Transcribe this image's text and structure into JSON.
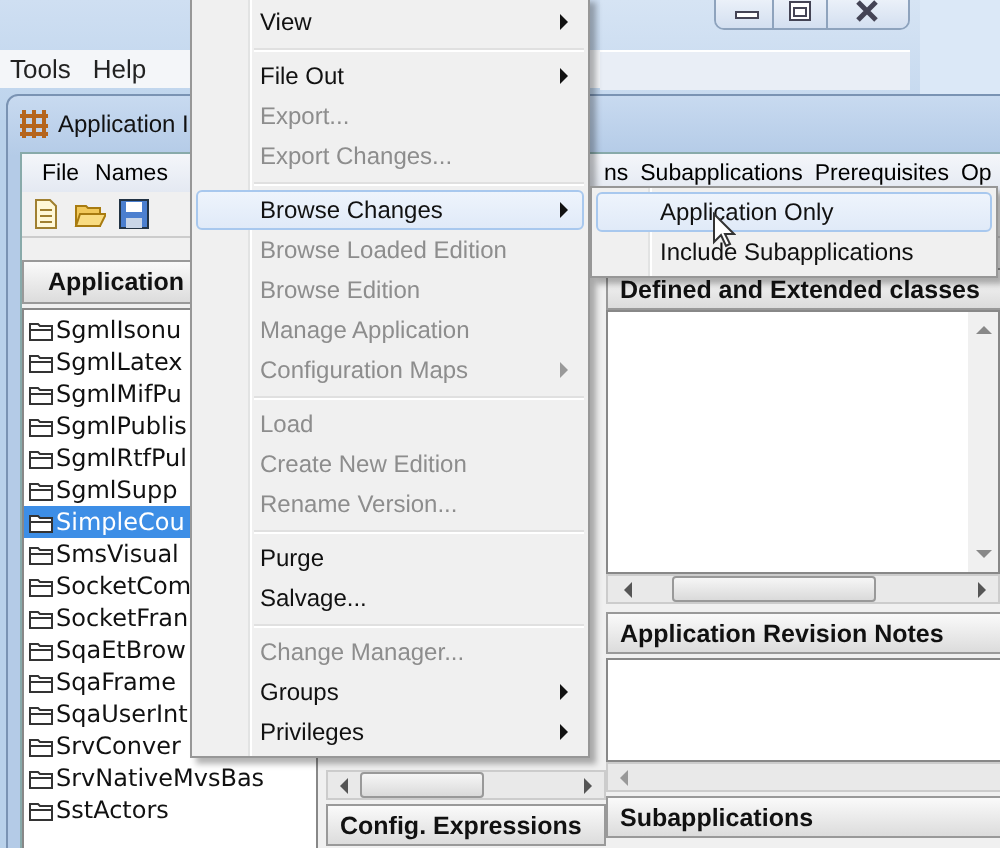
{
  "background_window": {
    "menu": [
      "Tools",
      "Help"
    ]
  },
  "app_window": {
    "title": "Application I",
    "menu": [
      "File",
      "Names",
      "ns",
      "Subapplications",
      "Prerequisites",
      "Op"
    ],
    "applications_header": "Application",
    "applications": [
      {
        "name": "SgmlIsonu",
        "selected": false
      },
      {
        "name": "SgmlLatex",
        "selected": false
      },
      {
        "name": "SgmlMifPu",
        "selected": false
      },
      {
        "name": "SgmlPublis",
        "selected": false
      },
      {
        "name": "SgmlRtfPul",
        "selected": false
      },
      {
        "name": "SgmlSupp",
        "selected": false
      },
      {
        "name": "SimpleCou",
        "selected": true
      },
      {
        "name": "SmsVisual",
        "selected": false
      },
      {
        "name": "SocketCom",
        "selected": false
      },
      {
        "name": "SocketFran",
        "selected": false
      },
      {
        "name": "SqaEtBrow",
        "selected": false
      },
      {
        "name": "SqaFrame",
        "selected": false
      },
      {
        "name": "SqaUserInt",
        "selected": false
      },
      {
        "name": "SrvConver",
        "selected": false
      },
      {
        "name": "SrvNativeMvsBas",
        "selected": false
      },
      {
        "name": "SstActors",
        "selected": false
      }
    ],
    "classes_header": "Defined and Extended classes",
    "notes_header": "Application Revision Notes",
    "config_header": "Config. Expressions",
    "subapplications_header": "Subapplications"
  },
  "context_menu": {
    "items": [
      {
        "kind": "item",
        "label": "View",
        "disabled": false,
        "submenu": true,
        "selected": false
      },
      {
        "kind": "separator"
      },
      {
        "kind": "item",
        "label": "File Out",
        "disabled": false,
        "submenu": true,
        "selected": false
      },
      {
        "kind": "item",
        "label": "Export...",
        "disabled": true,
        "submenu": false,
        "selected": false
      },
      {
        "kind": "item",
        "label": "Export Changes...",
        "disabled": true,
        "submenu": false,
        "selected": false
      },
      {
        "kind": "separator"
      },
      {
        "kind": "item",
        "label": "Browse Changes",
        "disabled": false,
        "submenu": true,
        "selected": true
      },
      {
        "kind": "item",
        "label": "Browse Loaded Edition",
        "disabled": true,
        "submenu": false,
        "selected": false
      },
      {
        "kind": "item",
        "label": "Browse Edition",
        "disabled": true,
        "submenu": false,
        "selected": false
      },
      {
        "kind": "item",
        "label": "Manage Application",
        "disabled": true,
        "submenu": false,
        "selected": false
      },
      {
        "kind": "item",
        "label": "Configuration Maps",
        "disabled": true,
        "submenu": true,
        "selected": false
      },
      {
        "kind": "separator"
      },
      {
        "kind": "item",
        "label": "Load",
        "disabled": true,
        "submenu": false,
        "selected": false
      },
      {
        "kind": "item",
        "label": "Create New Edition",
        "disabled": true,
        "submenu": false,
        "selected": false
      },
      {
        "kind": "item",
        "label": "Rename Version...",
        "disabled": true,
        "submenu": false,
        "selected": false
      },
      {
        "kind": "separator"
      },
      {
        "kind": "item",
        "label": "Purge",
        "disabled": false,
        "submenu": false,
        "selected": false
      },
      {
        "kind": "item",
        "label": "Salvage...",
        "disabled": false,
        "submenu": false,
        "selected": false
      },
      {
        "kind": "separator"
      },
      {
        "kind": "item",
        "label": "Change Manager...",
        "disabled": true,
        "submenu": false,
        "selected": false
      },
      {
        "kind": "item",
        "label": "Groups",
        "disabled": false,
        "submenu": true,
        "selected": false
      },
      {
        "kind": "item",
        "label": "Privileges",
        "disabled": false,
        "submenu": true,
        "selected": false
      }
    ]
  },
  "submenu": {
    "items": [
      {
        "kind": "item",
        "label": "Application Only",
        "disabled": false,
        "submenu": false,
        "selected": true
      },
      {
        "kind": "item",
        "label": "Include Subapplications",
        "disabled": false,
        "submenu": false,
        "selected": false
      }
    ]
  }
}
